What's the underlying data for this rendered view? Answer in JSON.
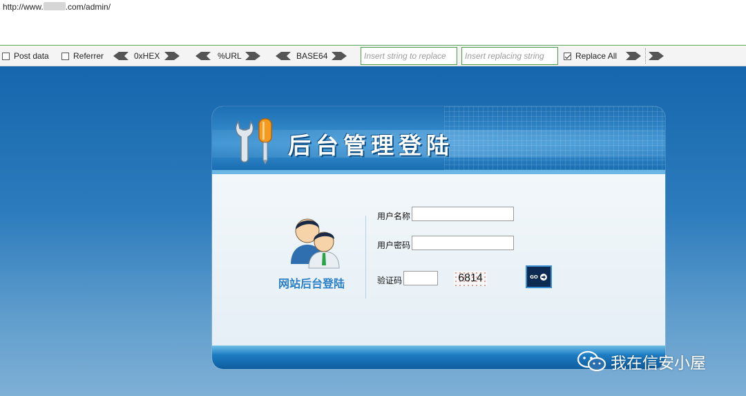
{
  "url_bar": {
    "prefix": "http://www.",
    "suffix": ".com/admin/"
  },
  "toolbar": {
    "post_data": {
      "label": "Post data",
      "checked": false
    },
    "referrer": {
      "label": "Referrer",
      "checked": false
    },
    "hex_label": "0xHEX",
    "url_label": "%URL",
    "base64_label": "BASE64",
    "replace_placeholder": "Insert string to replace",
    "replacing_placeholder": "Insert replacing string",
    "replace_all": {
      "label": "Replace All",
      "checked": true
    }
  },
  "login": {
    "banner_title": "后台管理登陆",
    "site_label": "网站后台登陆",
    "username_label": "用户名称",
    "username_value": "",
    "password_label": "用户密码",
    "password_value": "",
    "captcha_label": "验证码",
    "captcha_value": "",
    "captcha_code": "6814",
    "go_label": "GO"
  },
  "watermark": {
    "text": "我在信安小屋",
    "icon": "wechat-icon"
  },
  "colors": {
    "page_blue": "#1566ad",
    "toolbar_green_border": "#4a9a4a",
    "site_label_blue": "#2a7fc8"
  }
}
